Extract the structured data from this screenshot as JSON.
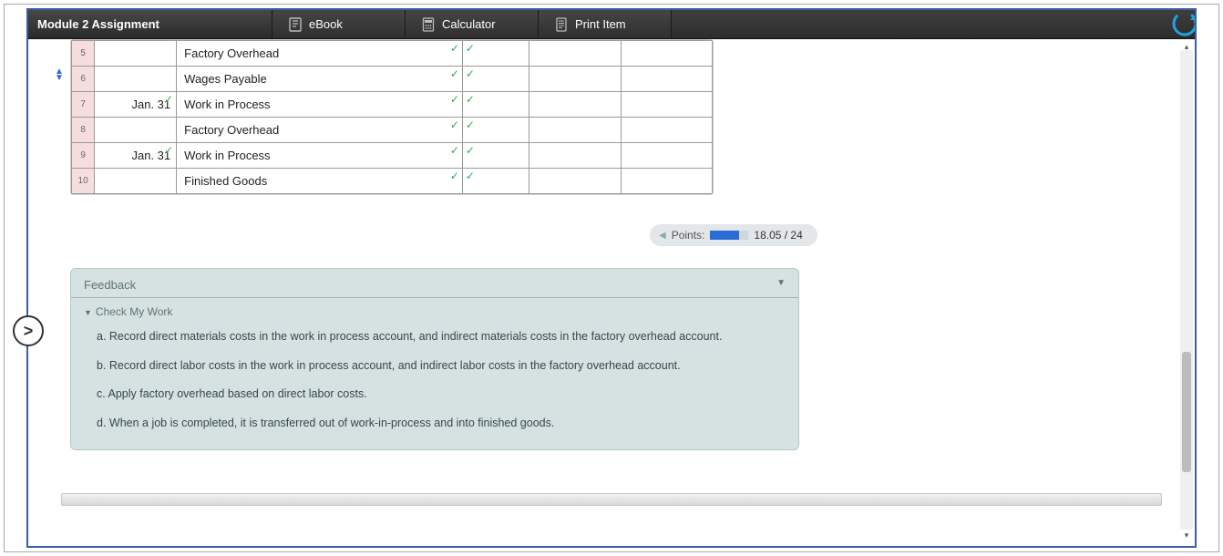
{
  "header": {
    "title": "Module 2 Assignment",
    "buttons": {
      "ebook": "eBook",
      "calculator": "Calculator",
      "printitem": "Print Item"
    }
  },
  "journal": {
    "rows": [
      {
        "num": "5",
        "date": "",
        "desc": "Factory Overhead",
        "date_check": false,
        "desc_check": true,
        "col_check": true
      },
      {
        "num": "6",
        "date": "",
        "desc": "Wages Payable",
        "date_check": false,
        "desc_check": true,
        "col_check": true
      },
      {
        "num": "7",
        "date": "Jan. 31",
        "desc": "Work in Process",
        "date_check": true,
        "desc_check": true,
        "col_check": true
      },
      {
        "num": "8",
        "date": "",
        "desc": "Factory Overhead",
        "date_check": false,
        "desc_check": true,
        "col_check": true
      },
      {
        "num": "9",
        "date": "Jan. 31",
        "desc": "Work in Process",
        "date_check": true,
        "desc_check": true,
        "col_check": true
      },
      {
        "num": "10",
        "date": "",
        "desc": "Finished Goods",
        "date_check": false,
        "desc_check": true,
        "col_check": true
      }
    ]
  },
  "points": {
    "label": "Points:",
    "value": "18.05 / 24"
  },
  "feedback": {
    "title": "Feedback",
    "subtitle": "Check My Work",
    "items": [
      "a. Record direct materials costs in the work in process account, and indirect materials costs in the factory overhead account.",
      "b. Record direct labor costs in the work in process account, and indirect labor costs in the factory overhead account.",
      "c. Apply factory overhead based on direct labor costs.",
      "d. When a job is completed, it is transferred out of work-in-process and into finished goods."
    ]
  },
  "fab": ">"
}
